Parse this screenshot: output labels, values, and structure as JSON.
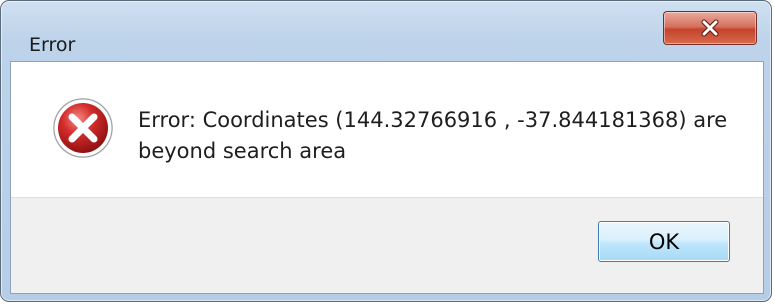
{
  "window": {
    "title": "Error"
  },
  "icons": {
    "close": "close-icon",
    "status": "error-icon"
  },
  "dialog": {
    "message": "Error: Coordinates (144.32766916 , -37.844181368) are beyond search area",
    "ok_label": "OK"
  },
  "colors": {
    "close_button": "#c4432c",
    "error_icon": "#d22b2b",
    "ok_button_border": "#3c7fb1"
  }
}
